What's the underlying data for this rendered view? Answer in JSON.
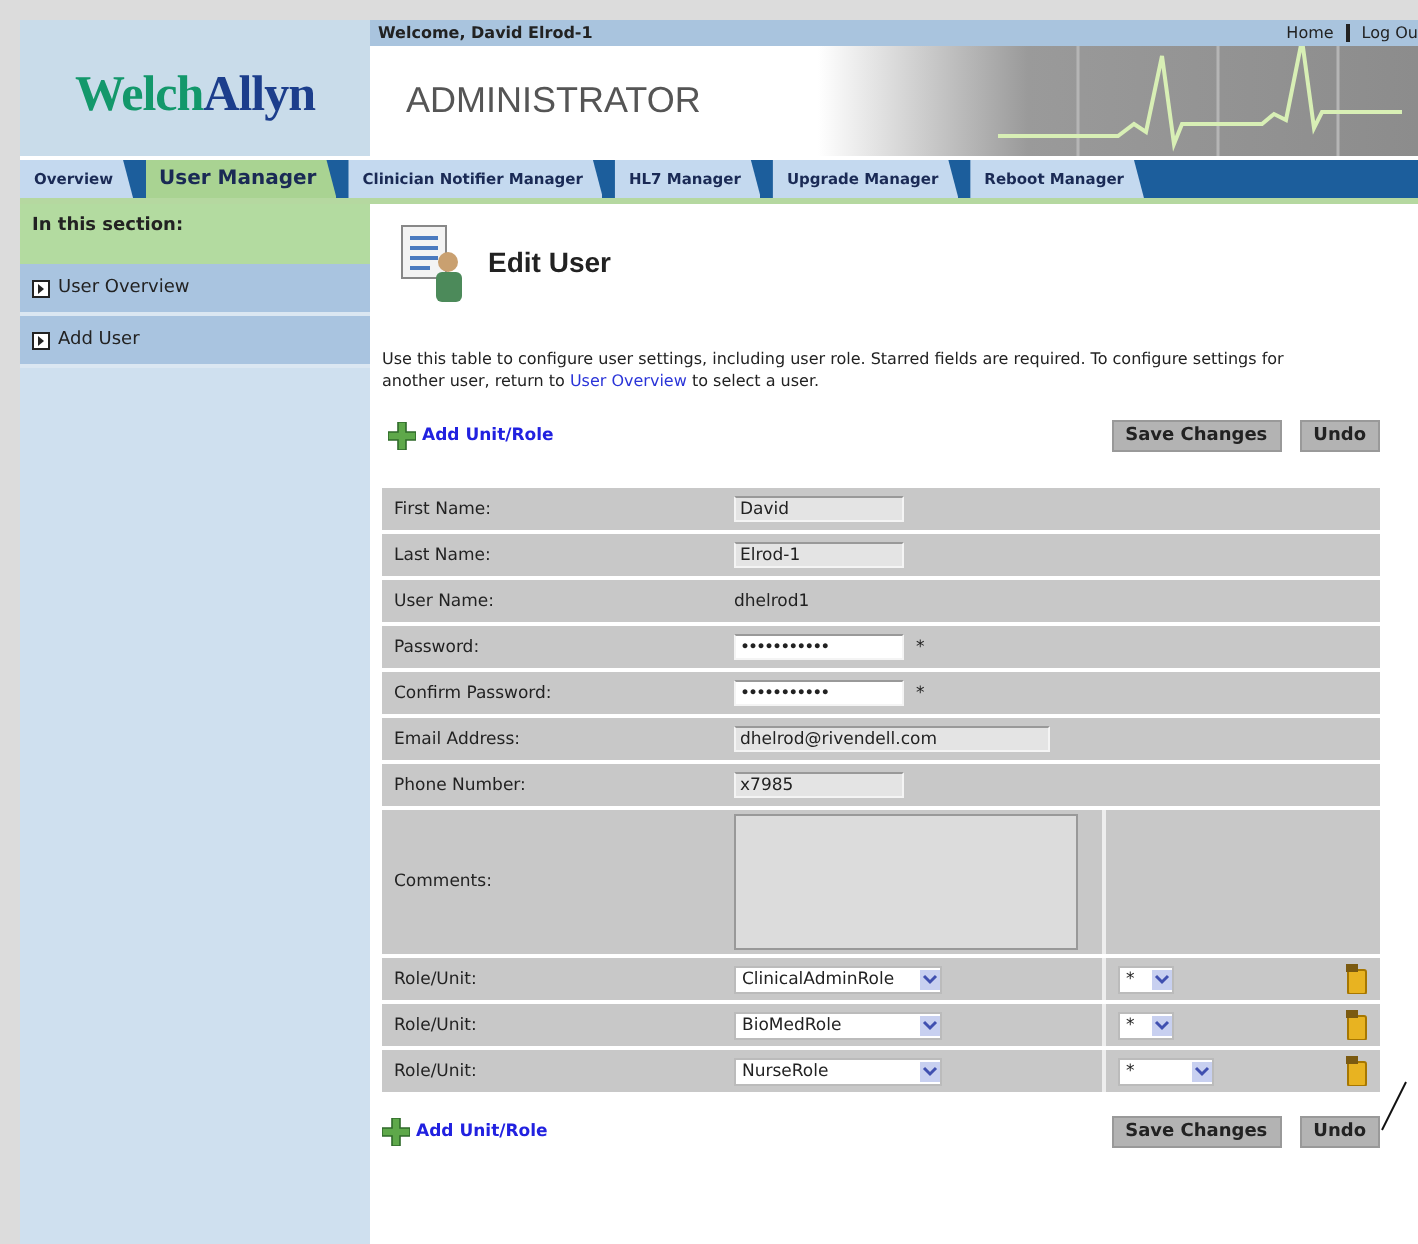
{
  "header": {
    "welcome": "Welcome, David Elrod-1",
    "links": [
      "Home",
      "Log Ou"
    ],
    "logo": {
      "first": "Welch",
      "second": "Allyn"
    },
    "title": "ADMINISTRATOR"
  },
  "tabs": [
    {
      "label": "Overview",
      "selected": false
    },
    {
      "label": "User Manager",
      "selected": true
    },
    {
      "label": "Clinician Notifier Manager",
      "selected": false
    },
    {
      "label": "HL7 Manager",
      "selected": false
    },
    {
      "label": "Upgrade Manager",
      "selected": false
    },
    {
      "label": "Reboot Manager",
      "selected": false
    }
  ],
  "sidebar": {
    "heading": "In this section:",
    "items": [
      {
        "label": "User Overview"
      },
      {
        "label": "Add User"
      }
    ]
  },
  "page": {
    "title": "Edit User",
    "intro_before": "Use this table to configure user settings, including user role. Starred fields are required. To configure settings for another user, return to ",
    "intro_link": "User Overview",
    "intro_after": " to select a user.",
    "add_link": "Add Unit/Role",
    "buttons": [
      "Save Changes",
      "Undo"
    ]
  },
  "fields": [
    {
      "kind": "input",
      "label": "First Name:",
      "value": "David"
    },
    {
      "kind": "input",
      "label": "Last Name:",
      "value": "Elrod-1"
    },
    {
      "kind": "static",
      "label": "User Name:",
      "value": "dhelrod1"
    },
    {
      "kind": "password",
      "label": "Password:",
      "value": "•••••••••••",
      "required": "*"
    },
    {
      "kind": "password",
      "label": "Confirm Password:",
      "value": "•••••••••••",
      "required": "*"
    },
    {
      "kind": "wide",
      "label": "Email Address:",
      "value": "dhelrod@rivendell.com"
    },
    {
      "kind": "input",
      "label": "Phone Number:",
      "value": "x7985"
    },
    {
      "kind": "textarea",
      "label": "Comments:"
    },
    {
      "kind": "role",
      "label": "Role/Unit:",
      "role": "ClinicalAdminRole",
      "unit": "*"
    },
    {
      "kind": "role",
      "label": "Role/Unit:",
      "role": "BioMedRole",
      "unit": "*"
    },
    {
      "kind": "role",
      "label": "Role/Unit:",
      "role": "NurseRole",
      "unit": "*"
    }
  ],
  "footer": {
    "add_link": "Add Unit/Role",
    "buttons": [
      "Save Changes",
      "Undo"
    ]
  }
}
